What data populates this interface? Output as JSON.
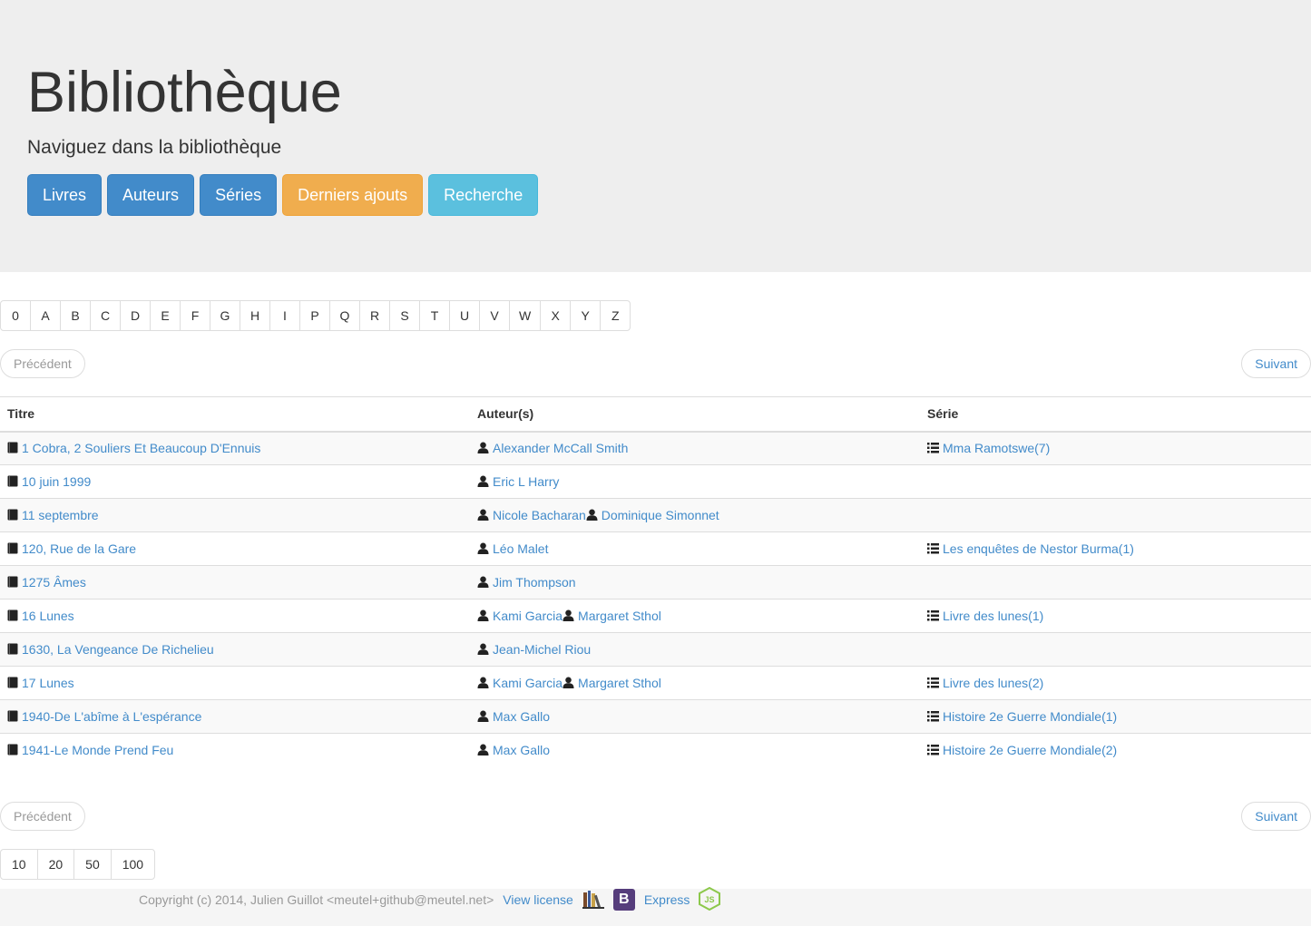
{
  "header": {
    "title": "Bibliothèque",
    "lead": "Naviguez dans la bibliothèque",
    "buttons": {
      "books": "Livres",
      "authors": "Auteurs",
      "series": "Séries",
      "latest": "Derniers ajouts",
      "search": "Recherche"
    },
    "colors": {
      "primary": "#428bca",
      "warning": "#f0ad4e",
      "info": "#5bc0de"
    }
  },
  "letters": [
    "0",
    "A",
    "B",
    "C",
    "D",
    "E",
    "F",
    "G",
    "H",
    "I",
    "P",
    "Q",
    "R",
    "S",
    "T",
    "U",
    "V",
    "W",
    "X",
    "Y",
    "Z"
  ],
  "pager": {
    "prev": "Précédent",
    "next": "Suivant"
  },
  "table": {
    "headers": {
      "title": "Titre",
      "authors": "Auteur(s)",
      "series": "Série"
    },
    "rows": [
      {
        "title": "1 Cobra, 2 Souliers Et Beaucoup D'Ennuis",
        "authors": [
          "Alexander McCall Smith"
        ],
        "series": "Mma Ramotswe(7)"
      },
      {
        "title": "10 juin 1999",
        "authors": [
          "Eric L Harry"
        ],
        "series": ""
      },
      {
        "title": "11 septembre",
        "authors": [
          "Nicole Bacharan",
          "Dominique Simonnet"
        ],
        "series": ""
      },
      {
        "title": "120, Rue de la Gare",
        "authors": [
          "Léo Malet"
        ],
        "series": "Les enquêtes de Nestor Burma(1)"
      },
      {
        "title": "1275 Âmes",
        "authors": [
          "Jim Thompson"
        ],
        "series": ""
      },
      {
        "title": "16 Lunes",
        "authors": [
          "Kami Garcia",
          "Margaret Sthol"
        ],
        "series": "Livre des lunes(1)"
      },
      {
        "title": "1630, La Vengeance De Richelieu",
        "authors": [
          "Jean-Michel Riou"
        ],
        "series": ""
      },
      {
        "title": "17 Lunes",
        "authors": [
          "Kami Garcia",
          "Margaret Sthol"
        ],
        "series": "Livre des lunes(2)"
      },
      {
        "title": "1940-De L'abîme à L'espérance",
        "authors": [
          "Max Gallo"
        ],
        "series": "Histoire 2e Guerre Mondiale(1)"
      },
      {
        "title": "1941-Le Monde Prend Feu",
        "authors": [
          "Max Gallo"
        ],
        "series": "Histoire 2e Guerre Mondiale(2)"
      }
    ]
  },
  "page_sizes": [
    "10",
    "20",
    "50",
    "100"
  ],
  "footer": {
    "copyright": "Copyright (c) 2014, Julien Guillot <meutel+github@meutel.net>",
    "license": "View license",
    "bootstrap_letter": "B",
    "express": "Express",
    "node_letters": "JS"
  },
  "icons": {
    "book": "book-icon",
    "user": "user-icon",
    "list": "list-icon"
  }
}
